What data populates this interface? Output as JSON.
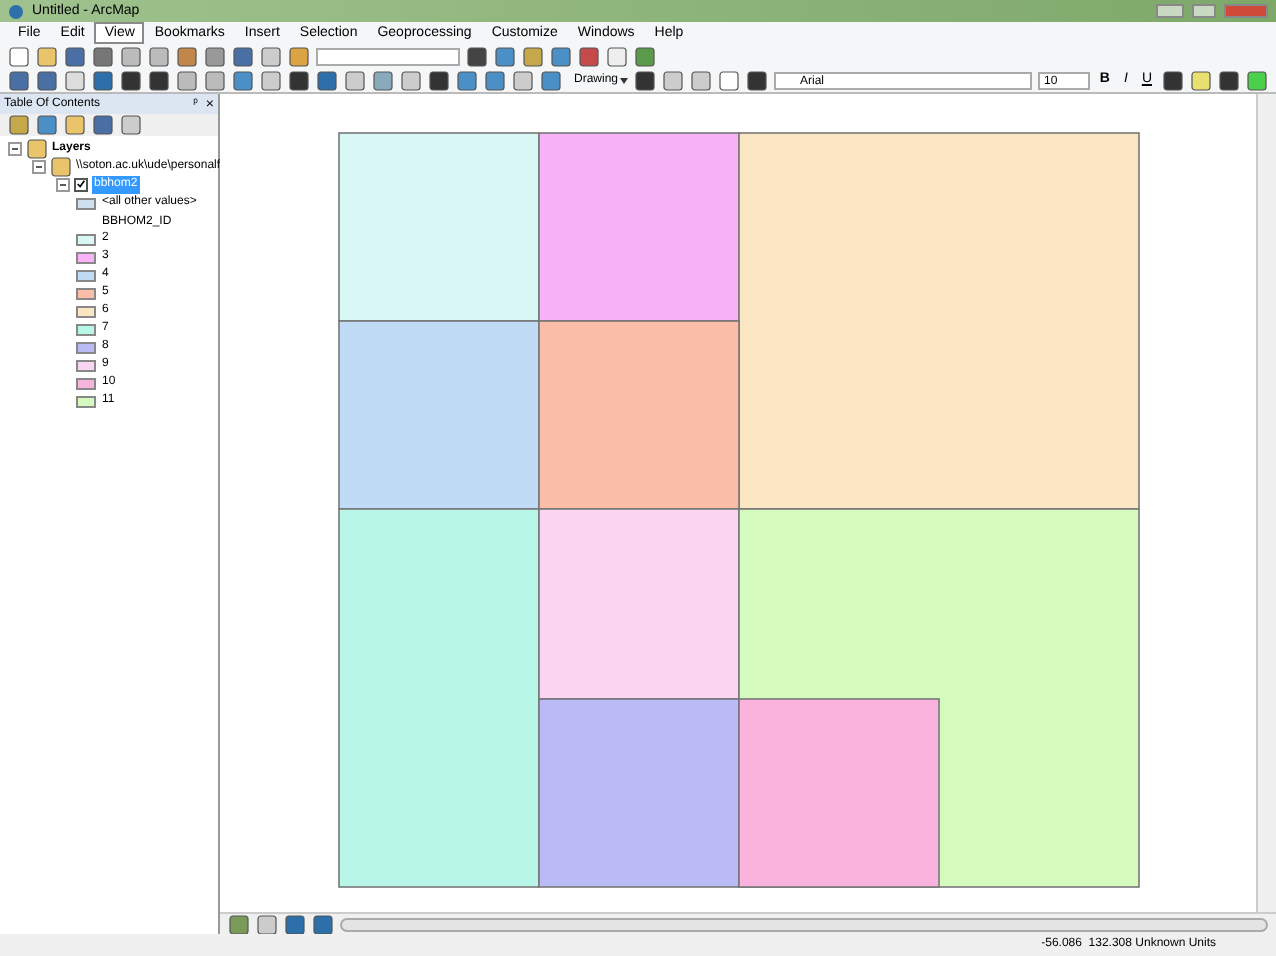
{
  "window": {
    "title": "Untitled - ArcMap"
  },
  "menu": [
    {
      "label": "File",
      "selected": false
    },
    {
      "label": "Edit",
      "selected": false
    },
    {
      "label": "View",
      "selected": true
    },
    {
      "label": "Bookmarks",
      "selected": false
    },
    {
      "label": "Insert",
      "selected": false
    },
    {
      "label": "Selection",
      "selected": false
    },
    {
      "label": "Geoprocessing",
      "selected": false
    },
    {
      "label": "Customize",
      "selected": false
    },
    {
      "label": "Windows",
      "selected": false
    },
    {
      "label": "Help",
      "selected": false
    }
  ],
  "drawing_toolbar": {
    "drawing_label": "Drawing",
    "font": "Arial",
    "font_size": "10",
    "bold": "B",
    "italic": "I",
    "underline": "U"
  },
  "toc": {
    "title": "Table Of Contents",
    "pin": "ᵖ",
    "close": "×",
    "root": {
      "label": "Layers",
      "expanded": true,
      "children": [
        {
          "label": "\\\\soton.ac.uk\\ude\\personalf",
          "expanded": true,
          "children": [
            {
              "label": "bbhom2",
              "checked": true,
              "selected": true,
              "expanded": true
            }
          ]
        }
      ]
    },
    "legend_other": {
      "label": "<all other values>",
      "color": "#cce0f0"
    },
    "field": "BBHOM2_ID",
    "legend": [
      {
        "label": "2",
        "color": "#d9f7f5"
      },
      {
        "label": "3",
        "color": "#f7b3f5"
      },
      {
        "label": "4",
        "color": "#bfdbf5"
      },
      {
        "label": "5",
        "color": "#fabda8"
      },
      {
        "label": "6",
        "color": "#fae6c2"
      },
      {
        "label": "7",
        "color": "#b8f7e8"
      },
      {
        "label": "8",
        "color": "#babaf7"
      },
      {
        "label": "9",
        "color": "#fad4f0"
      },
      {
        "label": "10",
        "color": "#fab3dc"
      },
      {
        "label": "11",
        "color": "#d4fabd"
      }
    ]
  },
  "status_bar": {
    "coordinates": "-56.086  132.308 Unknown Units"
  }
}
